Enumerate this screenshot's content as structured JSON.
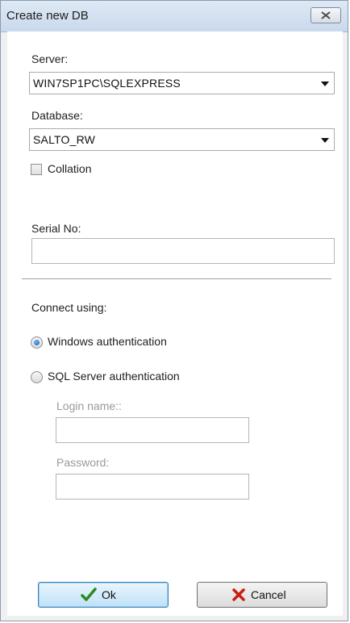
{
  "window": {
    "title": "Create new DB"
  },
  "server": {
    "label": "Server:",
    "value": "WIN7SP1PC\\SQLEXPRESS"
  },
  "database": {
    "label": "Database:",
    "value": "SALTO_RW"
  },
  "collation": {
    "label": "Collation",
    "checked": false
  },
  "serial": {
    "label": "Serial No:",
    "value": ""
  },
  "connect": {
    "label": "Connect using:",
    "windows_auth": {
      "label": "Windows authentication",
      "selected": true
    },
    "sql_auth": {
      "label": "SQL Server authentication",
      "selected": false
    },
    "login": {
      "label": "Login name::",
      "value": ""
    },
    "password": {
      "label": "Password:",
      "value": ""
    }
  },
  "buttons": {
    "ok": "Ok",
    "cancel": "Cancel"
  },
  "colors": {
    "ok_check": "#2d8a1f",
    "cancel_x": "#c81e12",
    "radio_dot": "#1c5fb8"
  }
}
